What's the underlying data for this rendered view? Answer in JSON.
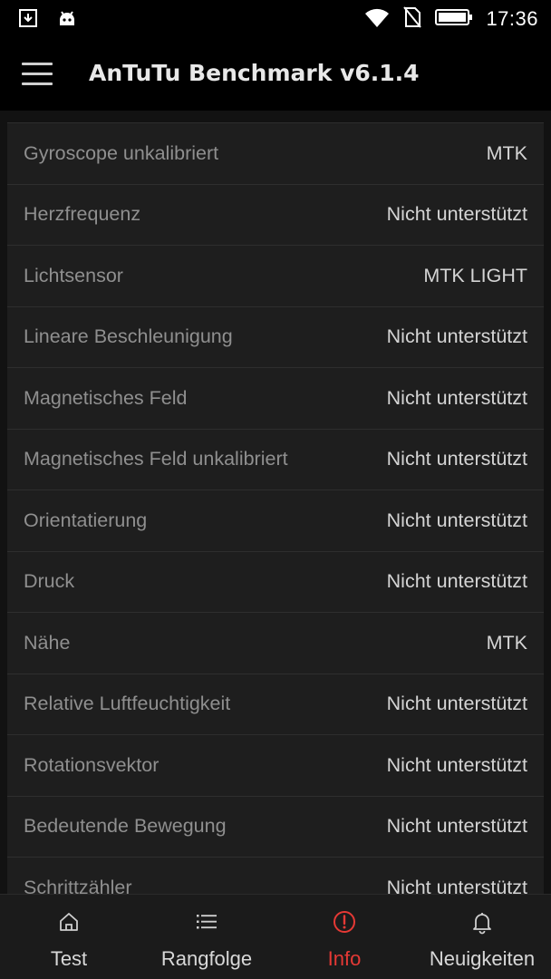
{
  "status_bar": {
    "time": "17:36",
    "icons": [
      "download-notification-icon",
      "android-icon",
      "wifi-icon",
      "no-sim-icon",
      "battery-icon"
    ]
  },
  "app_bar": {
    "title": "AnTuTu Benchmark v6.1.4",
    "menu_icon": "hamburger-menu-icon"
  },
  "sensor_list": [
    {
      "label": "Gyroscope unkalibriert",
      "value": "MTK"
    },
    {
      "label": "Herzfrequenz",
      "value": "Nicht unterstützt"
    },
    {
      "label": "Lichtsensor",
      "value": "MTK LIGHT"
    },
    {
      "label": "Lineare Beschleunigung",
      "value": "Nicht unterstützt"
    },
    {
      "label": "Magnetisches Feld",
      "value": "Nicht unterstützt"
    },
    {
      "label": "Magnetisches Feld unkalibriert",
      "value": "Nicht unterstützt"
    },
    {
      "label": "Orientatierung",
      "value": "Nicht unterstützt"
    },
    {
      "label": "Druck",
      "value": "Nicht unterstützt"
    },
    {
      "label": "Nähe",
      "value": "MTK"
    },
    {
      "label": "Relative Luftfeuchtigkeit",
      "value": "Nicht unterstützt"
    },
    {
      "label": "Rotationsvektor",
      "value": "Nicht unterstützt"
    },
    {
      "label": "Bedeutende Bewegung",
      "value": "Nicht unterstützt"
    },
    {
      "label": "Schrittzähler",
      "value": "Nicht unterstützt"
    }
  ],
  "bottom_nav": {
    "items": [
      {
        "label": "Test",
        "icon": "home-icon"
      },
      {
        "label": "Rangfolge",
        "icon": "list-icon"
      },
      {
        "label": "Info",
        "icon": "info-alert-icon",
        "active": true
      },
      {
        "label": "Neuigkeiten",
        "icon": "bell-icon"
      }
    ],
    "active_color": "#e53935"
  },
  "colors": {
    "background": "#121212",
    "row_background": "#1e1e1e",
    "label_text": "#8f8f8f",
    "value_text": "#d4d4d4"
  }
}
